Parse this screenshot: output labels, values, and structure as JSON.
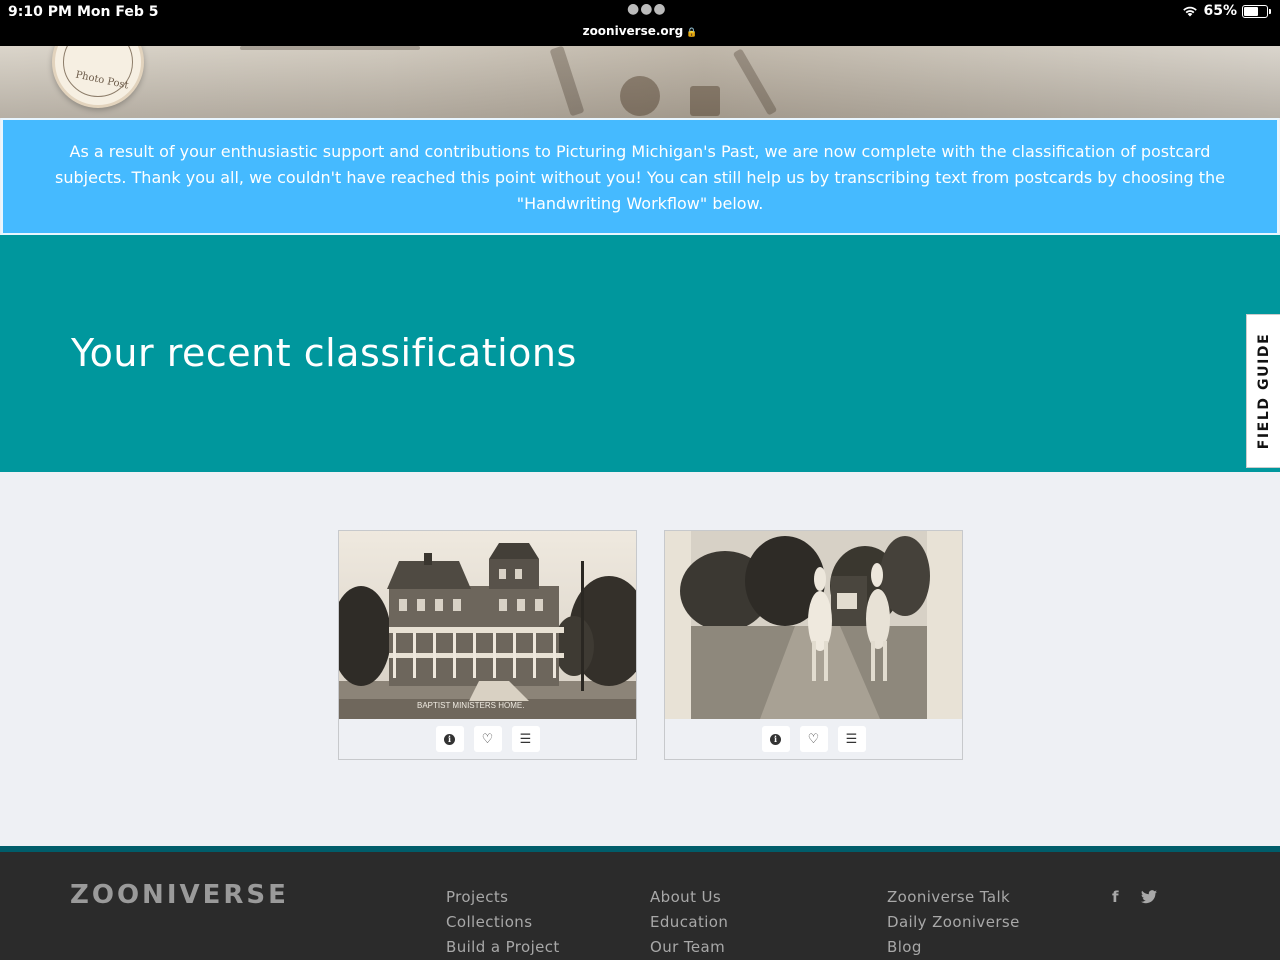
{
  "statusbar": {
    "time": "9:10 PM",
    "date": "Mon Feb 5",
    "url": "zooniverse.org",
    "battery": "65%",
    "battery_level": 0.65
  },
  "hero": {
    "logo_text": "Photo Post"
  },
  "announcement": {
    "text": "As a result of your enthusiastic support and contributions to Picturing Michigan's Past, we are now complete with the classification of postcard subjects. Thank you all, we couldn't have reached this point without you! You can still help us by transcribing text from postcards by choosing the \"Handwriting Workflow\" below."
  },
  "recent": {
    "title": "Your recent classifications"
  },
  "field_guide": {
    "label": "FIELD GUIDE"
  },
  "cards": [
    {
      "image": "house-postcard",
      "caption": "BAPTIST MINISTERS HOME."
    },
    {
      "image": "horse-carriage-postcard"
    }
  ],
  "footer": {
    "brand": "ZOONIVERSE",
    "col1": [
      "Projects",
      "Collections",
      "Build a Project"
    ],
    "col2": [
      "About Us",
      "Education",
      "Our Team"
    ],
    "col3": [
      "Zooniverse Talk",
      "Daily Zooniverse",
      "Blog"
    ],
    "social": [
      "facebook-icon",
      "twitter-icon"
    ]
  },
  "colors": {
    "announcement_bg": "#45baff",
    "teal_band": "#00979d",
    "footer_bg": "#2b2b2b"
  }
}
